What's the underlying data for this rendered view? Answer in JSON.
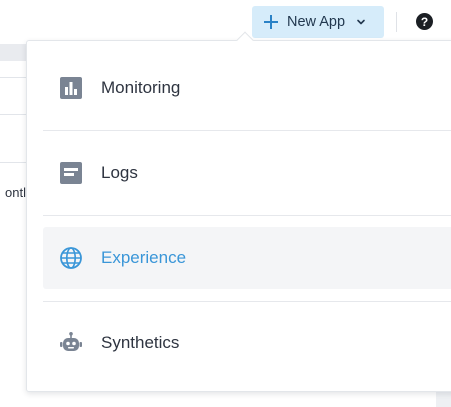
{
  "header": {
    "new_app_label": "New App",
    "help_label": "?"
  },
  "background": {
    "partial_text": "ontl"
  },
  "menu": {
    "items": [
      {
        "label": "Monitoring",
        "icon": "bar-chart-icon",
        "active": false
      },
      {
        "label": "Logs",
        "icon": "log-document-icon",
        "active": false
      },
      {
        "label": "Experience",
        "icon": "globe-icon",
        "active": true
      },
      {
        "label": "Synthetics",
        "icon": "robot-icon",
        "active": false
      }
    ]
  },
  "colors": {
    "accent": "#3a96d8",
    "button_bg": "#d6ecfa",
    "icon_gray": "#7a8493",
    "active_bg": "#f4f5f7"
  }
}
